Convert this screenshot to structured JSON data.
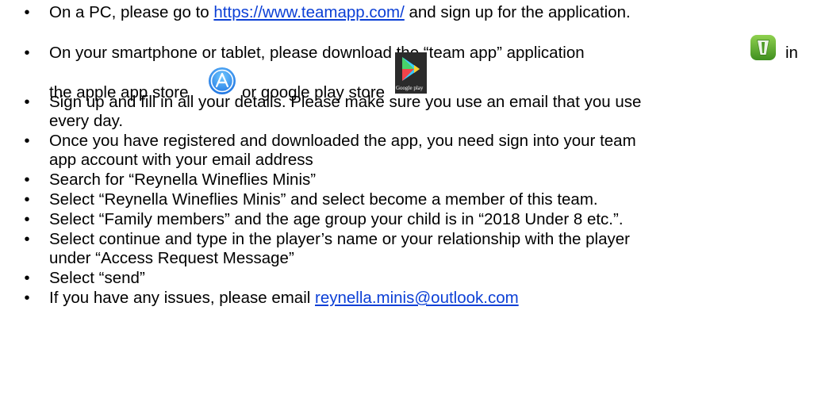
{
  "bullet_glyph": "•",
  "items": [
    {
      "before": "On a PC, please go to ",
      "link": "https://www.teamapp.com/",
      "after": " and sign up for the application."
    },
    {
      "line1_before_icon": "On your smartphone or tablet, please download the “team app” application ",
      "line1_after_icon": "in",
      "line2_a": "the apple app store ",
      "line2_b": " or google play store",
      "icons": {
        "team_app": "team-app-icon",
        "apple_store": "app-store-icon",
        "google_play": "google-play-icon"
      },
      "google_play_caption": "Google play"
    },
    {
      "line1": "Sign up and fill in all your details. Please make sure you use an email that you use",
      "line2": "every day."
    },
    {
      "line1": "Once you have registered and downloaded the app, you need sign into your team",
      "line2": "app account with your email address"
    },
    {
      "text": "Search for “Reynella Wineflies Minis”"
    },
    {
      "text": "Select “Reynella Wineflies Minis” and select become a member of this team."
    },
    {
      "text": "Select “Family members” and the age group your child is in “2018 Under 8 etc.”."
    },
    {
      "line1": "Select continue and type in the player’s name or your relationship with the player",
      "line2": "under “Access Request Message”"
    },
    {
      "text": "Select “send”"
    },
    {
      "before": "If you have any issues, please email ",
      "link": "reynella.minis@outlook.com"
    }
  ],
  "colors": {
    "link": "#0b3fd6",
    "team_app_green": "#5aa629",
    "app_store_blue": "#1e8ff0"
  }
}
